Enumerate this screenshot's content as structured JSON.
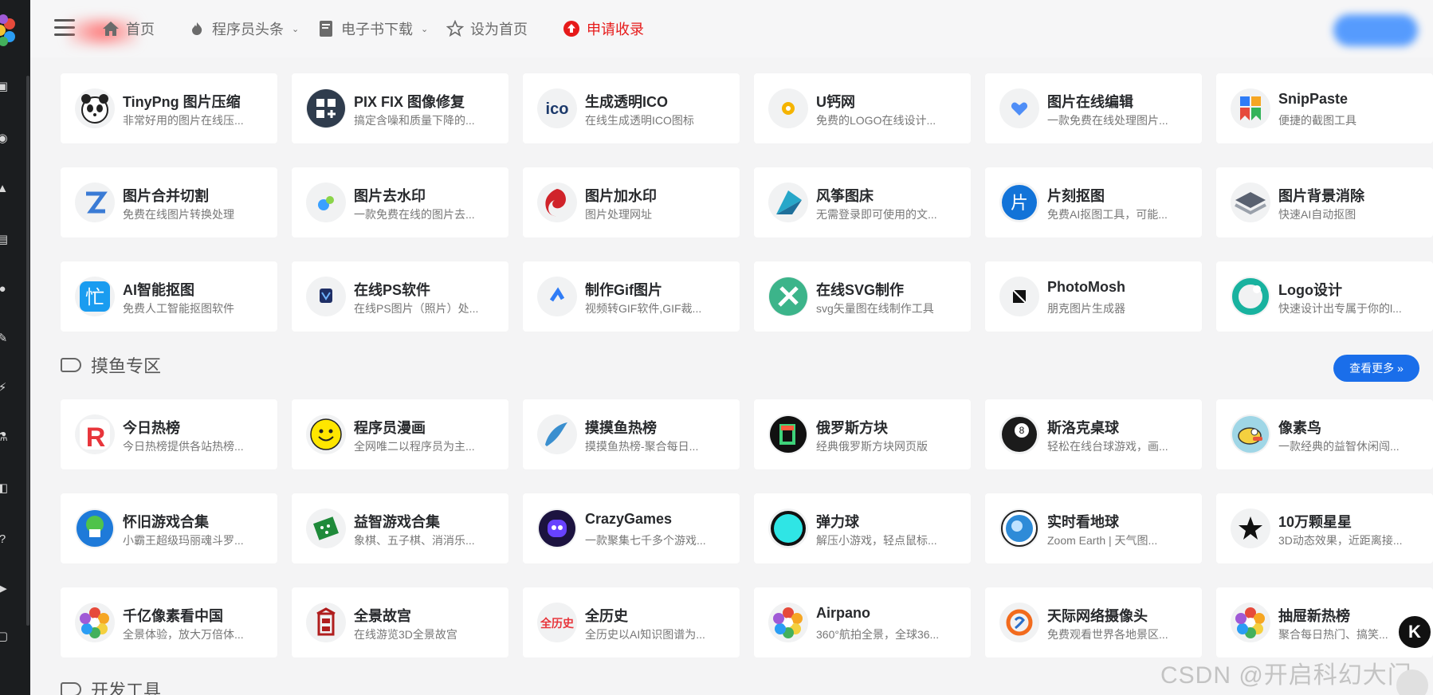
{
  "header": {
    "nav": [
      {
        "label": "首页",
        "icon": "home-icon"
      },
      {
        "label": "程序员头条",
        "icon": "fire-icon",
        "dropdown": true
      },
      {
        "label": "电子书下载",
        "icon": "book-icon",
        "dropdown": true
      },
      {
        "label": "设为首页",
        "icon": "star-icon"
      },
      {
        "label": "申请收录",
        "icon": "upload-icon",
        "color": "#e61a1a"
      }
    ]
  },
  "cards_top": [
    {
      "title": "TinyPng 图片压缩",
      "desc": "非常好用的图片在线压...",
      "icon": "panda-icon"
    },
    {
      "title": "PIX FIX 图像修复",
      "desc": "搞定含噪和质量下降的...",
      "icon": "pixfix-icon"
    },
    {
      "title": "生成透明ICO",
      "desc": "在线生成透明ICO图标",
      "icon": "ico-icon"
    },
    {
      "title": "U钙网",
      "desc": "免费的LOGO在线设计...",
      "icon": "gear-yellow-icon"
    },
    {
      "title": "图片在线编辑",
      "desc": "一款免费在线处理图片...",
      "icon": "heart-icon"
    },
    {
      "title": "SnipPaste",
      "desc": "便捷的截图工具",
      "icon": "snippaste-icon"
    },
    {
      "title": "图片合并切割",
      "desc": "免费在线图片转换处理",
      "icon": "z-icon"
    },
    {
      "title": "图片去水印",
      "desc": "一款免费在线的图片去...",
      "icon": "watermark-remove-icon"
    },
    {
      "title": "图片加水印",
      "desc": "图片处理网址",
      "icon": "swirl-icon"
    },
    {
      "title": "风筝图床",
      "desc": "无需登录即可使用的文...",
      "icon": "kite-icon"
    },
    {
      "title": "片刻抠图",
      "desc": "免费AI抠图工具，可能...",
      "icon": "pian-icon"
    },
    {
      "title": "图片背景消除",
      "desc": "快速AI自动抠图",
      "icon": "layers-icon"
    },
    {
      "title": "AI智能抠图",
      "desc": "免费人工智能抠图软件",
      "icon": "mang-icon"
    },
    {
      "title": "在线PS软件",
      "desc": "在线PS图片（照片）处...",
      "icon": "ps-icon"
    },
    {
      "title": "制作Gif图片",
      "desc": "视频转GIF软件,GIF裁...",
      "icon": "gif-icon"
    },
    {
      "title": "在线SVG制作",
      "desc": "svg矢量图在线制作工具",
      "icon": "tools-icon"
    },
    {
      "title": "PhotoMosh",
      "desc": "朋克图片生成器",
      "icon": "photomosh-icon"
    },
    {
      "title": "Logo设计",
      "desc": "快速设计出专属于你的l...",
      "icon": "logo-ring-icon"
    }
  ],
  "section_fish": {
    "title": "摸鱼专区",
    "more_label": "查看更多"
  },
  "cards_fish": [
    {
      "title": "今日热榜",
      "desc": "今日热榜提供各站热榜...",
      "icon": "r-flame-icon"
    },
    {
      "title": "程序员漫画",
      "desc": "全网唯二以程序员为主...",
      "icon": "smiley-icon"
    },
    {
      "title": "摸摸鱼热榜",
      "desc": "摸摸鱼热榜-聚合每日...",
      "icon": "fish-icon"
    },
    {
      "title": "俄罗斯方块",
      "desc": "经典俄罗斯方块网页版",
      "icon": "tetris-icon"
    },
    {
      "title": "斯洛克桌球",
      "desc": "轻松在线台球游戏，画...",
      "icon": "eight-ball-icon"
    },
    {
      "title": "像素鸟",
      "desc": "一款经典的益智休闲闯...",
      "icon": "flappy-bird-icon"
    },
    {
      "title": "怀旧游戏合集",
      "desc": "小霸王超级玛丽魂斗罗...",
      "icon": "mario-icon"
    },
    {
      "title": "益智游戏合集",
      "desc": "象棋、五子棋、消消乐...",
      "icon": "board-icon"
    },
    {
      "title": "CrazyGames",
      "desc": "一款聚集七千多个游戏...",
      "icon": "crazygames-icon"
    },
    {
      "title": "弹力球",
      "desc": "解压小游戏，轻点鼠标...",
      "icon": "ball-icon"
    },
    {
      "title": "实时看地球",
      "desc": "Zoom Earth | 天气图...",
      "icon": "earth-icon"
    },
    {
      "title": "10万颗星星",
      "desc": "3D动态效果，近距离接...",
      "icon": "star-black-icon"
    },
    {
      "title": "千亿像素看中国",
      "desc": "全景体验，放大万倍体...",
      "icon": "flower-icon"
    },
    {
      "title": "全景故宫",
      "desc": "在线游览3D全景故宫",
      "icon": "palace-icon"
    },
    {
      "title": "全历史",
      "desc": "全历史以AI知识图谱为...",
      "icon": "quanlishi-icon"
    },
    {
      "title": "Airpano",
      "desc": "360°航拍全景，全球36...",
      "icon": "flower-icon"
    },
    {
      "title": "天际网络摄像头",
      "desc": "免费观看世界各地景区...",
      "icon": "camera-icon"
    },
    {
      "title": "抽屉新热榜",
      "desc": "聚合每日热门、搞笑...",
      "icon": "flower-icon"
    }
  ],
  "section_dev": {
    "title": "开发工具"
  },
  "watermark": "CSDN @开启科幻大门",
  "float_button": "K"
}
